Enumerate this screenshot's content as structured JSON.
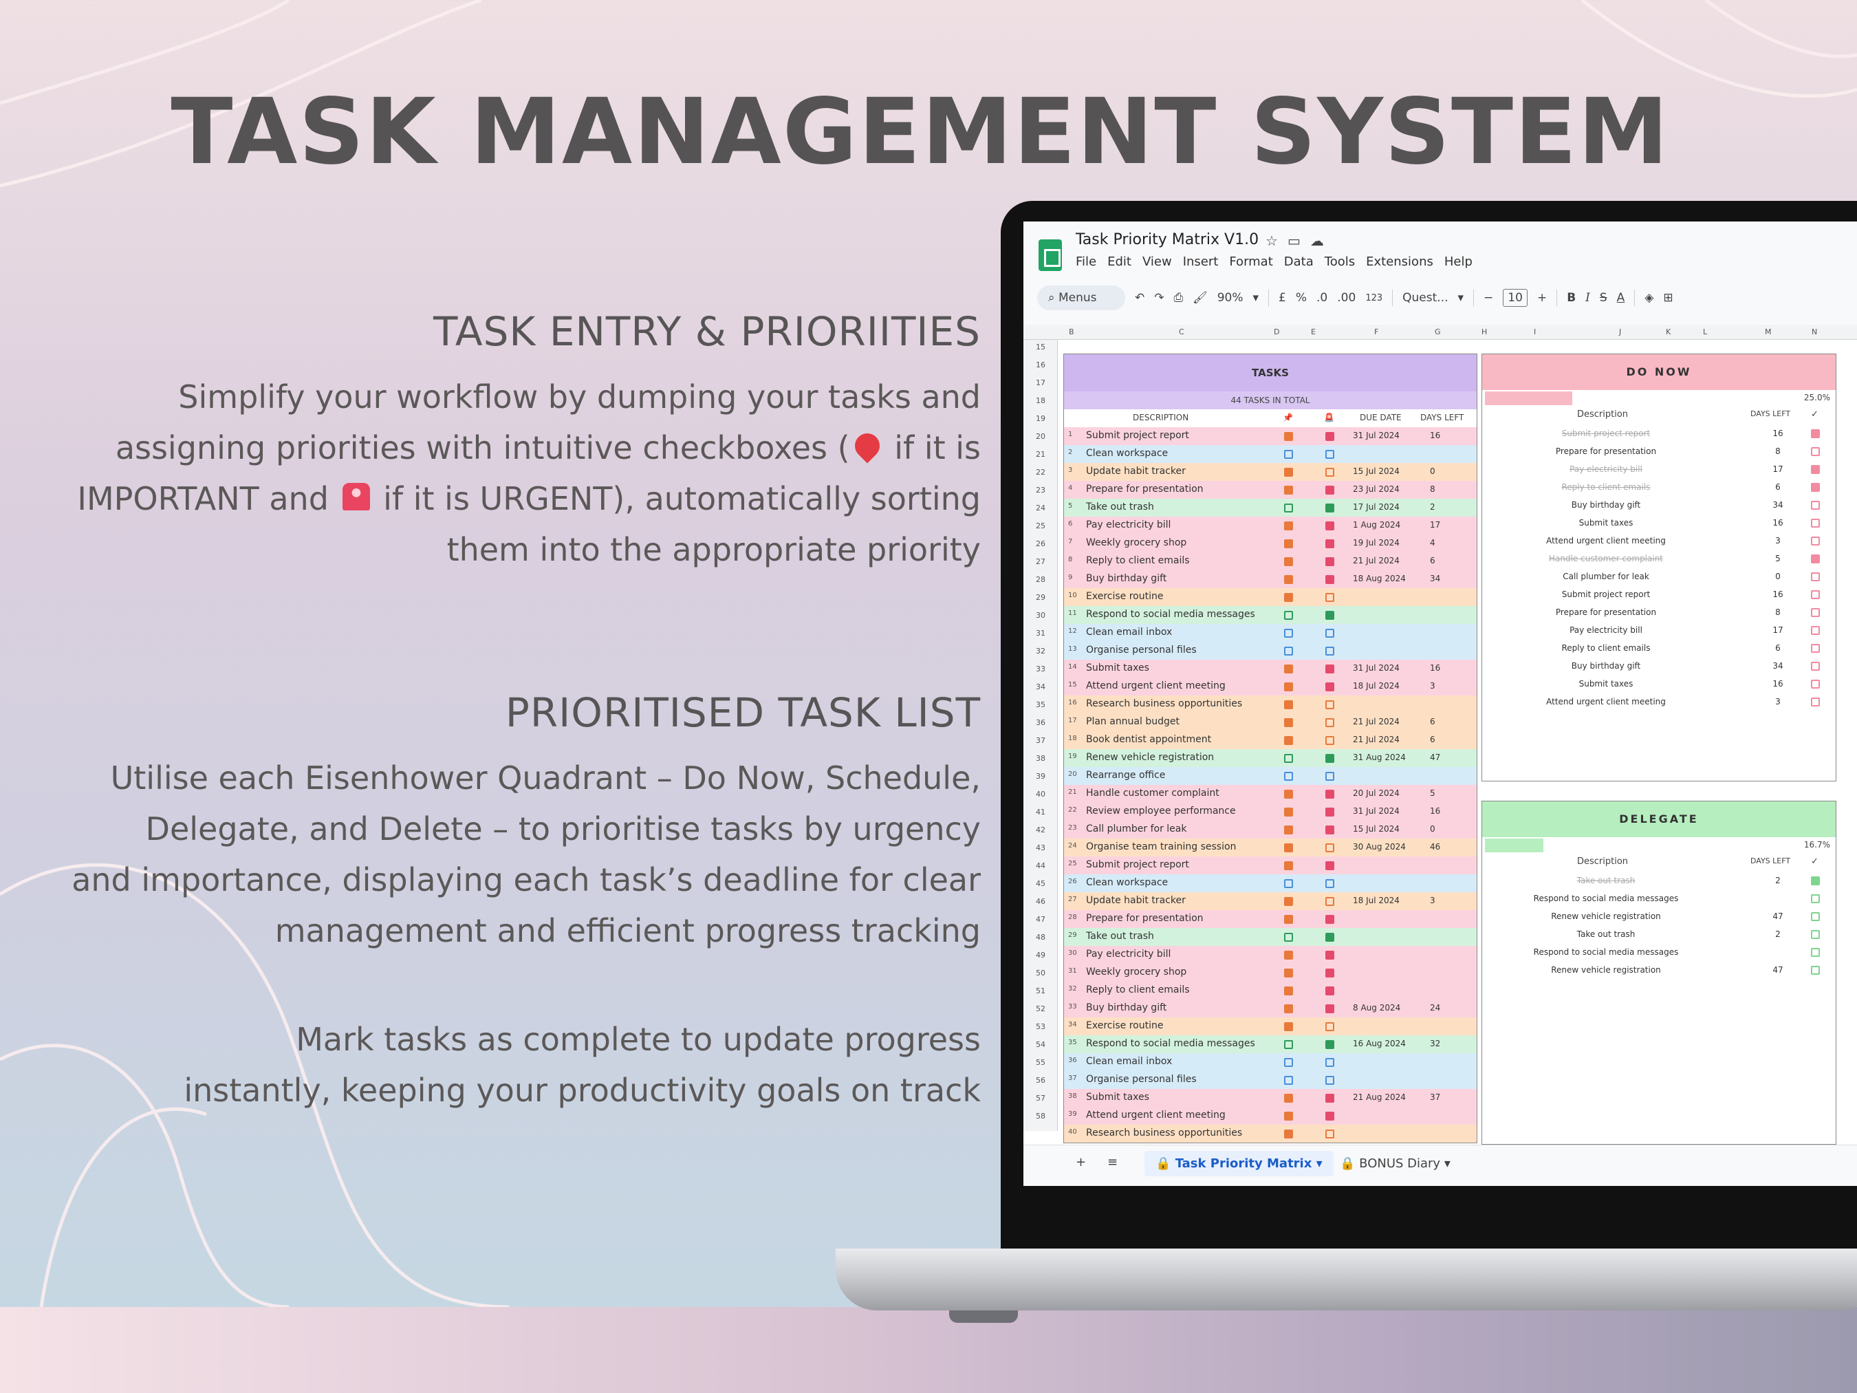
{
  "page": {
    "title": "TASK MANAGEMENT SYSTEM",
    "section1": {
      "heading": "TASK ENTRY & PRIORIITIES",
      "lines": [
        "Simplify your workflow by dumping your tasks and",
        "assigning priorities with intuitive checkboxes  (",
        " if it is",
        "IMPORTANT and ",
        " if it is URGENT), automatically sorting",
        "them into the appropriate priority"
      ]
    },
    "section2": {
      "heading": "PRIORITISED TASK LIST",
      "lines": [
        "Utilise each Eisenhower Quadrant – Do Now, Schedule,",
        "Delegate, and Delete – to prioritise tasks by urgency",
        "and importance, displaying each task’s deadline for clear",
        "management and efficient progress tracking"
      ]
    },
    "section3": {
      "lines": [
        "Mark tasks as complete to update progress",
        "instantly, keeping your productivity goals on track"
      ]
    }
  },
  "app": {
    "doc_title": "Task Priority Matrix V1.0",
    "title_icons": [
      "star-icon",
      "folder-icon",
      "cloud-icon"
    ],
    "menu": [
      "File",
      "Edit",
      "View",
      "Insert",
      "Format",
      "Data",
      "Tools",
      "Extensions",
      "Help"
    ],
    "toolbar": {
      "search": "Menus",
      "zoom": "90%",
      "currency": "£",
      "percent": "%",
      "dec_less": ".0",
      "dec_more": ".00",
      "num_format": "123",
      "font": "Quest...",
      "font_size": "10",
      "minus": "−",
      "plus": "+"
    },
    "column_letters": [
      "B",
      "C",
      "D",
      "E",
      "F",
      "G",
      "H",
      "I",
      "J",
      "K",
      "L",
      "M",
      "N"
    ],
    "row_numbers": [
      15,
      16,
      17,
      18,
      19,
      20,
      21,
      22,
      23,
      24,
      25,
      26,
      27,
      28,
      29,
      30,
      31,
      32,
      33,
      34,
      35,
      36,
      37,
      38,
      39,
      40,
      41,
      42,
      43,
      44,
      45,
      46,
      47,
      48,
      49,
      50,
      51,
      52,
      53,
      54,
      55,
      56,
      57,
      58
    ],
    "tabs": {
      "active": "Task Priority Matrix",
      "second": "BONUS Diary",
      "add": "+",
      "list": "≡"
    }
  },
  "tasks": {
    "heading": "TASKS",
    "total": "44 TASKS IN TOTAL",
    "col_description": "DESCRIPTION",
    "col_due": "DUE DATE",
    "col_left": "DAYS LEFT",
    "rows": [
      {
        "n": "1",
        "d": "Submit project report",
        "i": true,
        "u": true,
        "due": "31 Jul 2024",
        "left": "16",
        "bg": "#fbd3de"
      },
      {
        "n": "2",
        "d": "Clean workspace",
        "i": false,
        "u": false,
        "due": "",
        "left": "",
        "bg": "#d6ebf8"
      },
      {
        "n": "3",
        "d": "Update habit tracker",
        "i": true,
        "u": false,
        "due": "15 Jul 2024",
        "left": "0",
        "bg": "#fde0c4"
      },
      {
        "n": "4",
        "d": "Prepare for presentation",
        "i": true,
        "u": true,
        "due": "23 Jul 2024",
        "left": "8",
        "bg": "#fbd3de"
      },
      {
        "n": "5",
        "d": "Take out trash",
        "i": false,
        "u": true,
        "due": "17 Jul 2024",
        "left": "2",
        "bg": "#d3f2dd"
      },
      {
        "n": "6",
        "d": "Pay electricity bill",
        "i": true,
        "u": true,
        "due": "1 Aug 2024",
        "left": "17",
        "bg": "#fbd3de"
      },
      {
        "n": "7",
        "d": "Weekly grocery shop",
        "i": true,
        "u": true,
        "due": "19 Jul 2024",
        "left": "4",
        "bg": "#fbd3de"
      },
      {
        "n": "8",
        "d": "Reply to client emails",
        "i": true,
        "u": true,
        "due": "21 Jul 2024",
        "left": "6",
        "bg": "#fbd3de"
      },
      {
        "n": "9",
        "d": "Buy birthday gift",
        "i": true,
        "u": true,
        "due": "18 Aug 2024",
        "left": "34",
        "bg": "#fbd3de"
      },
      {
        "n": "10",
        "d": "Exercise routine",
        "i": true,
        "u": false,
        "due": "",
        "left": "",
        "bg": "#fde0c4"
      },
      {
        "n": "11",
        "d": "Respond to social media messages",
        "i": false,
        "u": true,
        "due": "",
        "left": "",
        "bg": "#d3f2dd"
      },
      {
        "n": "12",
        "d": "Clean email inbox",
        "i": false,
        "u": false,
        "due": "",
        "left": "",
        "bg": "#d6ebf8"
      },
      {
        "n": "13",
        "d": "Organise personal files",
        "i": false,
        "u": false,
        "due": "",
        "left": "",
        "bg": "#d6ebf8"
      },
      {
        "n": "14",
        "d": "Submit taxes",
        "i": true,
        "u": true,
        "due": "31 Jul 2024",
        "left": "16",
        "bg": "#fbd3de"
      },
      {
        "n": "15",
        "d": "Attend urgent client meeting",
        "i": true,
        "u": true,
        "due": "18 Jul 2024",
        "left": "3",
        "bg": "#fbd3de"
      },
      {
        "n": "16",
        "d": "Research business opportunities",
        "i": true,
        "u": false,
        "due": "",
        "left": "",
        "bg": "#fde0c4"
      },
      {
        "n": "17",
        "d": "Plan annual budget",
        "i": true,
        "u": false,
        "due": "21 Jul 2024",
        "left": "6",
        "bg": "#fde0c4"
      },
      {
        "n": "18",
        "d": "Book dentist appointment",
        "i": true,
        "u": false,
        "due": "21 Jul 2024",
        "left": "6",
        "bg": "#fde0c4"
      },
      {
        "n": "19",
        "d": "Renew vehicle registration",
        "i": false,
        "u": true,
        "due": "31 Aug 2024",
        "left": "47",
        "bg": "#d3f2dd"
      },
      {
        "n": "20",
        "d": "Rearrange office",
        "i": false,
        "u": false,
        "due": "",
        "left": "",
        "bg": "#d6ebf8"
      },
      {
        "n": "21",
        "d": "Handle customer complaint",
        "i": true,
        "u": true,
        "due": "20 Jul 2024",
        "left": "5",
        "bg": "#fbd3de"
      },
      {
        "n": "22",
        "d": "Review employee performance",
        "i": true,
        "u": true,
        "due": "31 Jul 2024",
        "left": "16",
        "bg": "#fbd3de"
      },
      {
        "n": "23",
        "d": "Call plumber for leak",
        "i": true,
        "u": true,
        "due": "15 Jul 2024",
        "left": "0",
        "bg": "#fbd3de"
      },
      {
        "n": "24",
        "d": "Organise team training session",
        "i": true,
        "u": false,
        "due": "30 Aug 2024",
        "left": "46",
        "bg": "#fde0c4"
      },
      {
        "n": "25",
        "d": "Submit project report",
        "i": true,
        "u": true,
        "due": "",
        "left": "",
        "bg": "#fbd3de"
      },
      {
        "n": "26",
        "d": "Clean workspace",
        "i": false,
        "u": false,
        "due": "",
        "left": "",
        "bg": "#d6ebf8"
      },
      {
        "n": "27",
        "d": "Update habit tracker",
        "i": true,
        "u": false,
        "due": "18 Jul 2024",
        "left": "3",
        "bg": "#fde0c4"
      },
      {
        "n": "28",
        "d": "Prepare for presentation",
        "i": true,
        "u": true,
        "due": "",
        "left": "",
        "bg": "#fbd3de"
      },
      {
        "n": "29",
        "d": "Take out trash",
        "i": false,
        "u": true,
        "due": "",
        "left": "",
        "bg": "#d3f2dd"
      },
      {
        "n": "30",
        "d": "Pay electricity bill",
        "i": true,
        "u": true,
        "due": "",
        "left": "",
        "bg": "#fbd3de"
      },
      {
        "n": "31",
        "d": "Weekly grocery shop",
        "i": true,
        "u": true,
        "due": "",
        "left": "",
        "bg": "#fbd3de"
      },
      {
        "n": "32",
        "d": "Reply to client emails",
        "i": true,
        "u": true,
        "due": "",
        "left": "",
        "bg": "#fbd3de"
      },
      {
        "n": "33",
        "d": "Buy birthday gift",
        "i": true,
        "u": true,
        "due": "8 Aug 2024",
        "left": "24",
        "bg": "#fbd3de"
      },
      {
        "n": "34",
        "d": "Exercise routine",
        "i": true,
        "u": false,
        "due": "",
        "left": "",
        "bg": "#fde0c4"
      },
      {
        "n": "35",
        "d": "Respond to social media messages",
        "i": false,
        "u": true,
        "due": "16 Aug 2024",
        "left": "32",
        "bg": "#d3f2dd"
      },
      {
        "n": "36",
        "d": "Clean email inbox",
        "i": false,
        "u": false,
        "due": "",
        "left": "",
        "bg": "#d6ebf8"
      },
      {
        "n": "37",
        "d": "Organise personal files",
        "i": false,
        "u": false,
        "due": "",
        "left": "",
        "bg": "#d6ebf8"
      },
      {
        "n": "38",
        "d": "Submit taxes",
        "i": true,
        "u": true,
        "due": "21 Aug 2024",
        "left": "37",
        "bg": "#fbd3de"
      },
      {
        "n": "39",
        "d": "Attend urgent client meeting",
        "i": true,
        "u": true,
        "due": "",
        "left": "",
        "bg": "#fbd3de"
      },
      {
        "n": "40",
        "d": "Research business opportunities",
        "i": true,
        "u": false,
        "due": "",
        "left": "",
        "bg": "#fde0c4"
      }
    ]
  },
  "do_now": {
    "heading": "DO NOW",
    "progress_pct": "25.0%",
    "progress": 0.25,
    "col_description": "Description",
    "col_left": "DAYS LEFT",
    "col_check": "✓",
    "color": "#f9b9c4",
    "rows": [
      {
        "d": "Submit project report",
        "left": "16",
        "done": true
      },
      {
        "d": "Prepare for presentation",
        "left": "8",
        "done": false
      },
      {
        "d": "Pay electricity bill",
        "left": "17",
        "done": true
      },
      {
        "d": "Reply to client emails",
        "left": "6",
        "done": true
      },
      {
        "d": "Buy birthday gift",
        "left": "34",
        "done": false
      },
      {
        "d": "Submit taxes",
        "left": "16",
        "done": false
      },
      {
        "d": "Attend urgent client meeting",
        "left": "3",
        "done": false
      },
      {
        "d": "Handle customer complaint",
        "left": "5",
        "done": true
      },
      {
        "d": "Call plumber for leak",
        "left": "0",
        "done": false
      },
      {
        "d": "Submit project report",
        "left": "16",
        "done": false
      },
      {
        "d": "Prepare for presentation",
        "left": "8",
        "done": false
      },
      {
        "d": "Pay electricity bill",
        "left": "17",
        "done": false
      },
      {
        "d": "Reply to client emails",
        "left": "6",
        "done": false
      },
      {
        "d": "Buy birthday gift",
        "left": "34",
        "done": false
      },
      {
        "d": "Submit taxes",
        "left": "16",
        "done": false
      },
      {
        "d": "Attend urgent client meeting",
        "left": "3",
        "done": false
      }
    ]
  },
  "delegate": {
    "heading": "DELEGATE",
    "progress_pct": "16.7%",
    "progress": 0.167,
    "col_description": "Description",
    "col_left": "DAYS LEFT",
    "col_check": "✓",
    "color": "#b7eebf",
    "rows": [
      {
        "d": "Take out trash",
        "left": "2",
        "done": true
      },
      {
        "d": "Respond to social media messages",
        "left": "",
        "done": false
      },
      {
        "d": "Renew vehicle registration",
        "left": "47",
        "done": false
      },
      {
        "d": "Take out trash",
        "left": "2",
        "done": false
      },
      {
        "d": "Respond to social media messages",
        "left": "",
        "done": false
      },
      {
        "d": "Renew vehicle registration",
        "left": "47",
        "done": false
      }
    ]
  }
}
